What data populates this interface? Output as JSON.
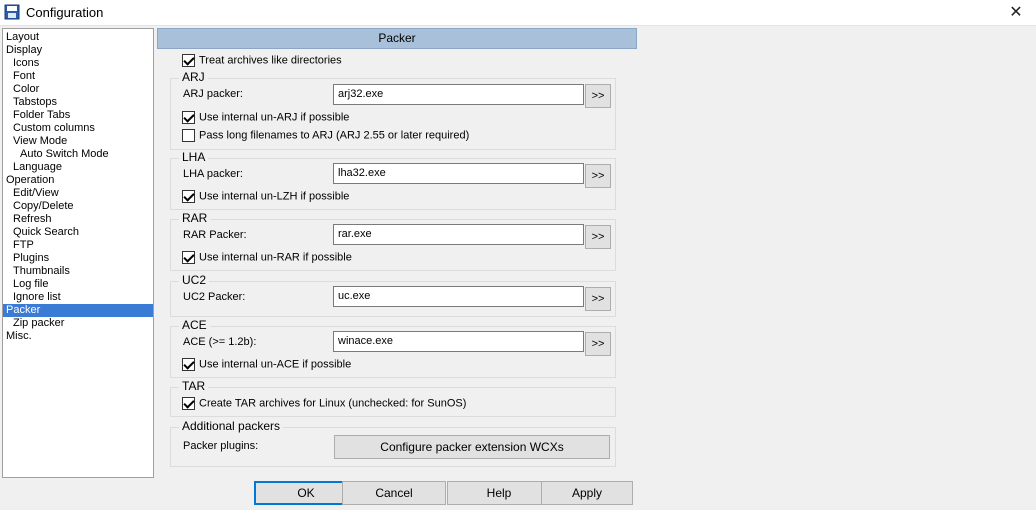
{
  "window": {
    "title": "Configuration",
    "close_glyph": "✕"
  },
  "tree": [
    {
      "label": "Layout",
      "indent": 0
    },
    {
      "label": "Display",
      "indent": 0
    },
    {
      "label": "Icons",
      "indent": 1
    },
    {
      "label": "Font",
      "indent": 1
    },
    {
      "label": "Color",
      "indent": 1
    },
    {
      "label": "Tabstops",
      "indent": 1
    },
    {
      "label": "Folder Tabs",
      "indent": 1
    },
    {
      "label": "Custom columns",
      "indent": 1
    },
    {
      "label": "View Mode",
      "indent": 1
    },
    {
      "label": "Auto Switch Mode",
      "indent": 2
    },
    {
      "label": "Language",
      "indent": 1
    },
    {
      "label": "Operation",
      "indent": 0
    },
    {
      "label": "Edit/View",
      "indent": 1
    },
    {
      "label": "Copy/Delete",
      "indent": 1
    },
    {
      "label": "Refresh",
      "indent": 1
    },
    {
      "label": "Quick Search",
      "indent": 1
    },
    {
      "label": "FTP",
      "indent": 1
    },
    {
      "label": "Plugins",
      "indent": 1
    },
    {
      "label": "Thumbnails",
      "indent": 1
    },
    {
      "label": "Log file",
      "indent": 1
    },
    {
      "label": "Ignore list",
      "indent": 1
    },
    {
      "label": "Packer",
      "indent": 0,
      "selected": true
    },
    {
      "label": "Zip packer",
      "indent": 1
    },
    {
      "label": "Misc.",
      "indent": 0
    }
  ],
  "panel": {
    "header": "Packer",
    "treat_archives": {
      "label": "Treat archives like directories",
      "checked": true
    },
    "arj": {
      "title": "ARJ",
      "packer_label": "ARJ packer:",
      "packer_value": "arj32.exe",
      "browse": ">>",
      "opt1": {
        "label": "Use internal un-ARJ if possible",
        "checked": true
      },
      "opt2": {
        "label": "Pass long filenames to ARJ (ARJ 2.55 or later required)",
        "checked": false
      }
    },
    "lha": {
      "title": "LHA",
      "packer_label": "LHA packer:",
      "packer_value": "lha32.exe",
      "browse": ">>",
      "opt1": {
        "label": "Use internal un-LZH if possible",
        "checked": true
      }
    },
    "rar": {
      "title": "RAR",
      "packer_label": "RAR Packer:",
      "packer_value": "rar.exe",
      "browse": ">>",
      "opt1": {
        "label": "Use internal un-RAR if possible",
        "checked": true
      }
    },
    "uc2": {
      "title": "UC2",
      "packer_label": "UC2 Packer:",
      "packer_value": "uc.exe",
      "browse": ">>"
    },
    "ace": {
      "title": "ACE",
      "packer_label": "ACE (>= 1.2b):",
      "packer_value": "winace.exe",
      "browse": ">>",
      "opt1": {
        "label": "Use internal un-ACE if possible",
        "checked": true
      }
    },
    "tar": {
      "title": "TAR",
      "opt1": {
        "label": "Create TAR archives for Linux (unchecked: for SunOS)",
        "checked": true
      }
    },
    "additional": {
      "title": "Additional packers",
      "plugins_label": "Packer plugins:",
      "configure_button": "Configure packer extension WCXs"
    }
  },
  "buttons": {
    "ok": "OK",
    "cancel": "Cancel",
    "help": "Help",
    "apply": "Apply"
  },
  "colors": {
    "selection": "#3a7bd5",
    "header_bg": "#a8c0da",
    "default_button_border": "#0078d7"
  }
}
